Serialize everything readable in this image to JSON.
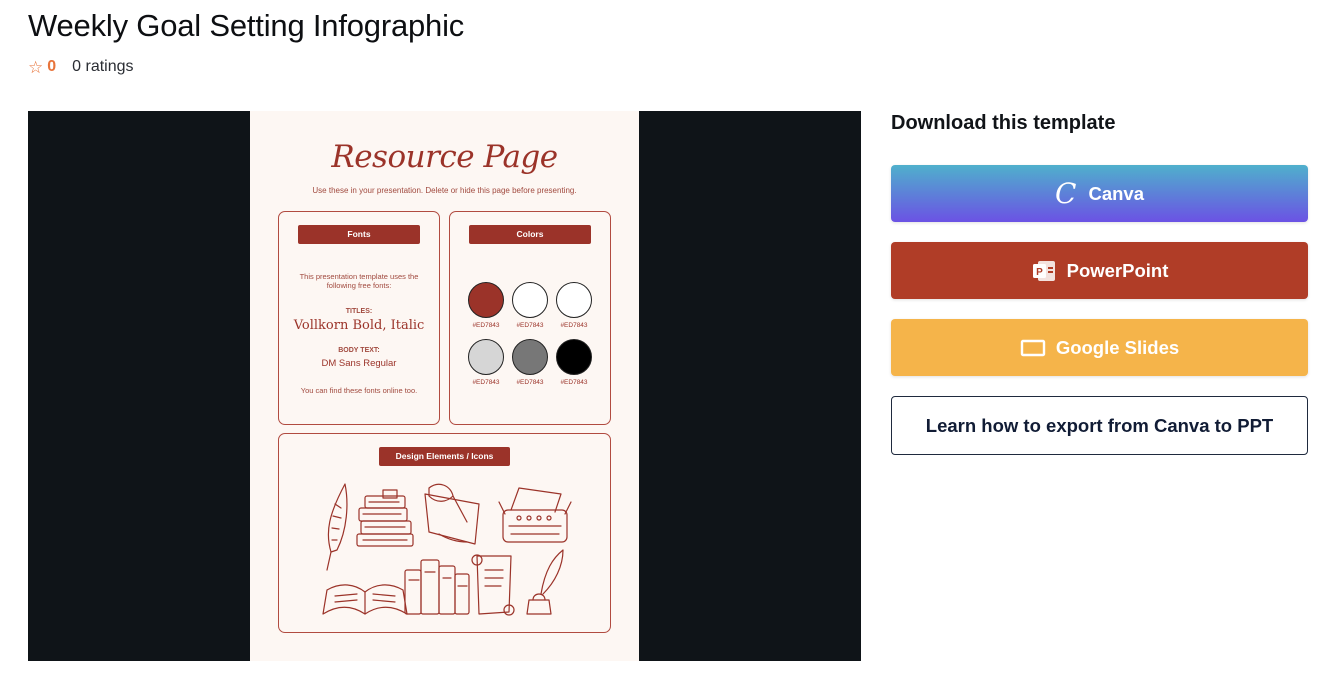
{
  "header": {
    "title": "Weekly Goal Setting Infographic",
    "rating_icon": "star-outline-icon",
    "rating_score": "0",
    "rating_count": "0 ratings"
  },
  "preview": {
    "slide_title": "Resource Page",
    "slide_subtitle": "Use these in your presentation. Delete or hide this page before presenting.",
    "fonts": {
      "pill": "Fonts",
      "intro": "This presentation template uses the following free fonts:",
      "titles_label": "TITLES:",
      "titles_value": "Vollkorn Bold, Italic",
      "body_label": "BODY TEXT:",
      "body_value": "DM Sans Regular",
      "footer": "You can find these fonts online too."
    },
    "colors": {
      "pill": "Colors",
      "swatches": [
        {
          "color": "#9b3329",
          "label": "#ED7843"
        },
        {
          "color": "#ffffff",
          "label": "#ED7843"
        },
        {
          "color": "#ffffff",
          "label": "#ED7843"
        },
        {
          "color": "#d6d6d6",
          "label": "#ED7843"
        },
        {
          "color": "#777777",
          "label": "#ED7843"
        },
        {
          "color": "#000000",
          "label": "#ED7843"
        }
      ]
    },
    "elements": {
      "pill": "Design Elements / Icons",
      "icons": [
        "quill-icon",
        "book-stack-icon",
        "writing-hand-icon",
        "typewriter-icon",
        "open-book-icon",
        "books-icon",
        "scroll-icon",
        "inkwell-icon"
      ]
    }
  },
  "download": {
    "heading": "Download this template",
    "canva_label": "Canva",
    "canva_icon": "canva-icon",
    "powerpoint_label": "PowerPoint",
    "powerpoint_icon": "powerpoint-icon",
    "gslides_label": "Google Slides",
    "gslides_icon": "google-slides-icon",
    "export_label": "Learn how to export from Canva to PPT"
  },
  "colors": {
    "accent": "#e8743b",
    "canva_top": "#4fb0cc",
    "canva_bottom": "#6b52e4",
    "powerpoint": "#b03d27",
    "gslides": "#f5b44a",
    "slide_red": "#9b3329"
  }
}
